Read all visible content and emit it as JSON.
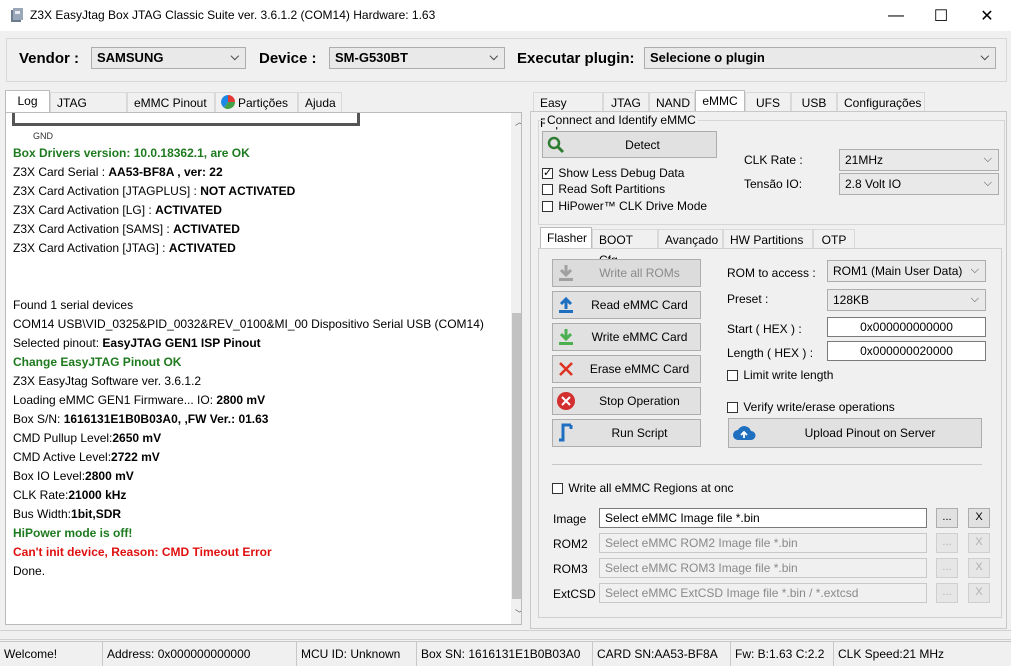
{
  "window": {
    "title": "Z3X EasyJtag Box JTAG Classic Suite ver. 3.6.1.2 (COM14) Hardware: 1.63",
    "minimize": "—",
    "maximize": "☐",
    "close": "✕"
  },
  "toolbar": {
    "vendor_label": "Vendor :",
    "vendor_value": "SAMSUNG",
    "device_label": "Device :",
    "device_value": "SM-G530BT",
    "plugin_label": "Executar plugin:",
    "plugin_value": "Selecione o plugin"
  },
  "left_tabs": [
    "Log",
    "JTAG Pinout",
    "eMMC Pinout",
    "Partições",
    "Ajuda"
  ],
  "log": {
    "gnd_label": "GND",
    "lines": [
      {
        "text": "Box Drivers version: 10.0.18362.1, are OK",
        "style": "green"
      },
      {
        "prefix": "Z3X Card Serial : ",
        "bold": "AA53-BF8A , ver: 22"
      },
      {
        "prefix": "Z3X Card Activation [JTAGPLUS] : ",
        "bold": "NOT ACTIVATED"
      },
      {
        "prefix": "Z3X Card Activation [LG] : ",
        "bold": "ACTIVATED"
      },
      {
        "prefix": "Z3X Card Activation [SAMS] : ",
        "bold": "ACTIVATED"
      },
      {
        "prefix": "Z3X Card Activation [JTAG] : ",
        "bold": "ACTIVATED"
      },
      {
        "text": "",
        "style": "plain"
      },
      {
        "text": "",
        "style": "plain"
      },
      {
        "text": "Found 1 serial devices",
        "style": "plain"
      },
      {
        "text": "COM14 USB\\VID_0325&PID_0032&REV_0100&MI_00 Dispositivo Serial USB (COM14)",
        "style": "plain"
      },
      {
        "prefix": "Selected pinout: ",
        "bold": "EasyJTAG GEN1 ISP Pinout"
      },
      {
        "text": "Change EasyJTAG Pinout OK",
        "style": "green"
      },
      {
        "text": "Z3X EasyJtag Software ver. 3.6.1.2",
        "style": "plain"
      },
      {
        "prefix": "Loading eMMC GEN1 Firmware... IO: ",
        "bold": "2800 mV"
      },
      {
        "prefix": "Box S/N: ",
        "bold": "1616131E1B0B03A0, ,FW Ver.: 01.63"
      },
      {
        "prefix": "CMD Pullup Level:",
        "bold": "2650 mV"
      },
      {
        "prefix": "CMD Active Level:",
        "bold": "2722 mV"
      },
      {
        "prefix": "Box IO Level:",
        "bold": "2800 mV"
      },
      {
        "prefix": "CLK Rate:",
        "bold": "21000 kHz"
      },
      {
        "prefix": "Bus Width:",
        "bold": "1bit,SDR"
      },
      {
        "text": "HiPower mode is off!",
        "style": "green"
      },
      {
        "text": "Can't init device, Reason: CMD Timeout Error",
        "style": "red"
      },
      {
        "text": "Done.",
        "style": "plain"
      }
    ]
  },
  "right_tabs": [
    "Easy Repair",
    "JTAG",
    "NAND",
    "eMMC",
    "UFS",
    "USB",
    "Configurações"
  ],
  "emmc": {
    "group_title": "Connect and Identify eMMC",
    "detect_label": "Detect",
    "show_less_debug": "Show Less Debug Data",
    "read_soft_partitions": "Read Soft Partitions",
    "hipower": "HiPower™ CLK Drive Mode",
    "clk_rate_label": "CLK Rate :",
    "clk_rate_value": "21MHz",
    "tensao_label": "Tensão IO:",
    "tensao_value": "2.8 Volt IO",
    "sub_tabs": [
      "Flasher",
      "BOOT Cfg.",
      "Avançado",
      "HW Partitions",
      "OTP"
    ],
    "buttons": {
      "write_all": "Write all ROMs",
      "read": "Read eMMC Card",
      "write": "Write eMMC Card",
      "erase": "Erase eMMC Card",
      "stop": "Stop Operation",
      "run_script": "Run Script",
      "upload": "Upload Pinout on Server"
    },
    "rom_access_label": "ROM to access :",
    "rom_access_value": "ROM1 (Main User Data)",
    "preset_label": "Preset :",
    "preset_value": "128KB",
    "start_label": "Start ( HEX ) :",
    "start_value": "0x000000000000",
    "length_label": "Length ( HEX ) :",
    "length_value": "0x000000020000",
    "limit_write": "Limit write length",
    "verify": "Verify write/erase operations",
    "write_all_regions": "Write all eMMC Regions at onc",
    "files": [
      {
        "label": "Image",
        "placeholder": "Select eMMC Image file *.bin",
        "enabled": true
      },
      {
        "label": "ROM2",
        "placeholder": "Select eMMC ROM2 Image file *.bin",
        "enabled": false
      },
      {
        "label": "ROM3",
        "placeholder": "Select eMMC ROM3 Image file *.bin",
        "enabled": false
      },
      {
        "label": "ExtCSD",
        "placeholder": "Select eMMC ExtCSD Image file *.bin / *.extcsd",
        "enabled": false
      }
    ],
    "browse": "...",
    "clear": "X"
  },
  "status": {
    "welcome": "Welcome!",
    "address": "Address: 0x000000000000",
    "mcu": "MCU ID: Unknown",
    "box_sn": "Box SN: 1616131E1B0B03A0",
    "card_sn": "CARD SN:AA53-BF8A",
    "fw": "Fw: B:1.63 C:2.2",
    "clk": "CLK Speed:21 MHz"
  },
  "colors": {
    "accent_green": "#1e7a1e",
    "error_red": "#e01010",
    "scroll_thumb": "#c2c2c2"
  }
}
